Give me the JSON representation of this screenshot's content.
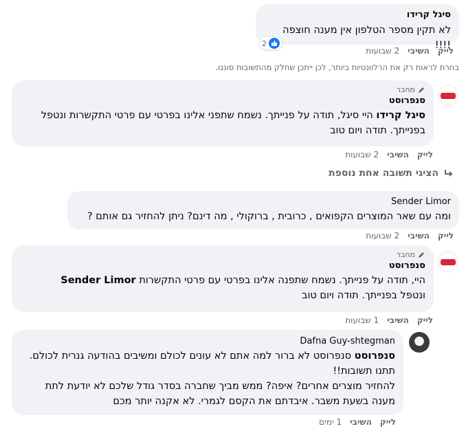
{
  "comments": [
    {
      "author": "סיגל קרידו",
      "text": "לא תקין מספר הטלפון אין מענה חוצפה !!!!",
      "time": "2 שבועות",
      "reply": "השיבי",
      "like": "לייק",
      "reactions": "2"
    },
    {
      "author": "סנפרוסט",
      "tag": "מחבר",
      "mention": "סיגל קרידו",
      "text": "היי סיגל, תודה על פנייתך. נשמח שתפני אלינו בפרטי עם פרטי התקשרות ונטפל בפנייתך. תודה ויום טוב",
      "time": "2 שבועות",
      "reply": "השיבי",
      "like": "לייק"
    },
    {
      "author": "Sender Limor",
      "text": "ומה עם שאר המוצרים הקפואים , כרובית , ברוקולי , מה דינם? ניתן להחזיר גם אותם ?",
      "time": "2 שבועות",
      "reply": "השיבי",
      "like": "לייק"
    },
    {
      "author": "סנפרוסט",
      "tag": "מחבר",
      "mention": "Sender Limor",
      "text": "היי, תודה על פנייתך. נשמח שתפנה אלינו בפרטי עם פרטי התקשרות",
      "text2": "ונטפל בפנייתך. תודה ויום טוב",
      "time": "1 שבועות",
      "reply": "השיבי",
      "like": "לייק"
    },
    {
      "author": "Dafna Guy-shtegman",
      "mention": "סנפרוסט",
      "text": "סנפרוסט לא ברור למה אתם לא עונים לכולם ומשיבים בהודעה גנרית לכולם. תתנו תשובות!!",
      "text2": "להחזיר מוצרים אחרים? איפה? ממש מביך שחברה בסדר גודל שלכם לא יודעת לתת מענה בשעת משבר. איבדתם את הקסם לגמרי. לא אקנה יותר מכם",
      "time": "1 ימים",
      "reply": "השיבי",
      "like": "לייק"
    }
  ],
  "notice": "בחרת לראות רק את הרלוונטיות ביותר, לכן ייתכן שחלק מהתשובות סוננו.",
  "show_more": "הציגי תשובה אחת נוספת",
  "colors": {
    "bubble": "#f0f2f5",
    "meta": "#65676b",
    "like_blue": "#1877f2",
    "logo_red": "#d7263d"
  }
}
